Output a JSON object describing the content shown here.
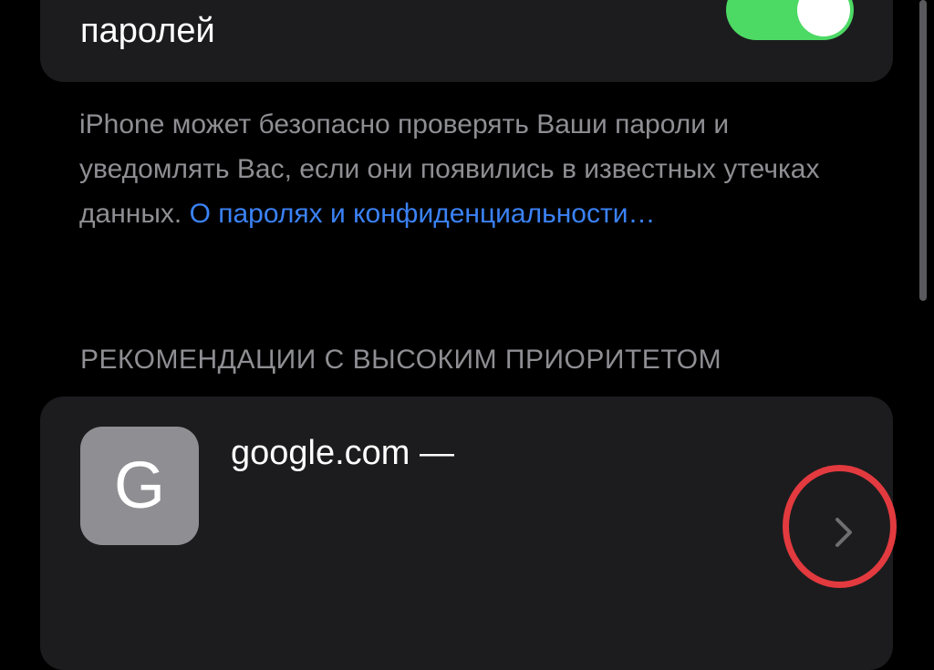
{
  "top_card": {
    "label": "паролей",
    "toggle_on": true
  },
  "footer": {
    "text": "iPhone может безопасно проверять Ваши пароли и уведомлять Вас, если они появились в известных утечках данных.",
    "link": "О паролях и конфиденциальности…"
  },
  "section": {
    "header": "РЕКОМЕНДАЦИИ С ВЫСОКИМ ПРИОРИТЕТОМ"
  },
  "recommendation": {
    "icon_letter": "G",
    "title": "google.com —"
  },
  "colors": {
    "background": "#000000",
    "card": "#1c1c1e",
    "toggle_on": "#4cd964",
    "link": "#3b82f6",
    "secondary_text": "#8e8e93",
    "highlight": "#e23a3f"
  }
}
